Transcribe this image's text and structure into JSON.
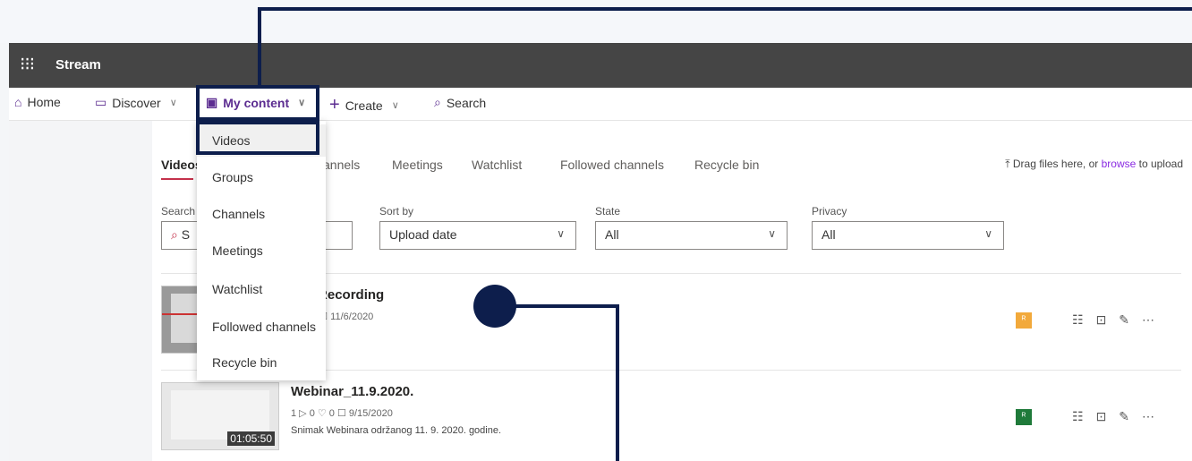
{
  "app": {
    "name": "Stream",
    "waffle_icon": "app-launcher-icon"
  },
  "nav": {
    "home": "Home",
    "discover": "Discover",
    "my_content": "My content",
    "create": "Create",
    "search": "Search",
    "chevron": "∨"
  },
  "tabs": [
    "Videos",
    "Groups",
    "Channels",
    "Meetings",
    "Watchlist",
    "Followed channels",
    "Recycle bin"
  ],
  "tab_partial": "annels",
  "upload": {
    "prefix": "Drag files here, or ",
    "link": "browse",
    "suffix": " to upload"
  },
  "filters": {
    "search_label": "Search",
    "search_placeholder": "S",
    "sort_label": "Sort by",
    "sort_value": "Upload date",
    "state_label": "State",
    "state_value": "All",
    "privacy_label": "Privacy",
    "privacy_value": "All"
  },
  "videos": [
    {
      "title": "een Recording",
      "meta": "0 ♡   0 ☐   11/6/2020",
      "duration": "",
      "privacy_color": "#f2a93b"
    },
    {
      "title": "Webinar_11.9.2020.",
      "meta": "1 ▷   0 ♡   0 ☐   9/15/2020",
      "description": "Snimak Webinara održanog 11. 9. 2020. godine.",
      "duration": "01:05:50",
      "privacy_color": "#1f7a3a"
    }
  ],
  "dropdown": [
    "Videos",
    "Groups",
    "Channels",
    "Meetings",
    "Watchlist",
    "Followed channels",
    "Recycle bin"
  ],
  "colors": {
    "accent": "#5c2d91",
    "annotation": "#0d1e4c",
    "suite_bar": "#454545"
  }
}
